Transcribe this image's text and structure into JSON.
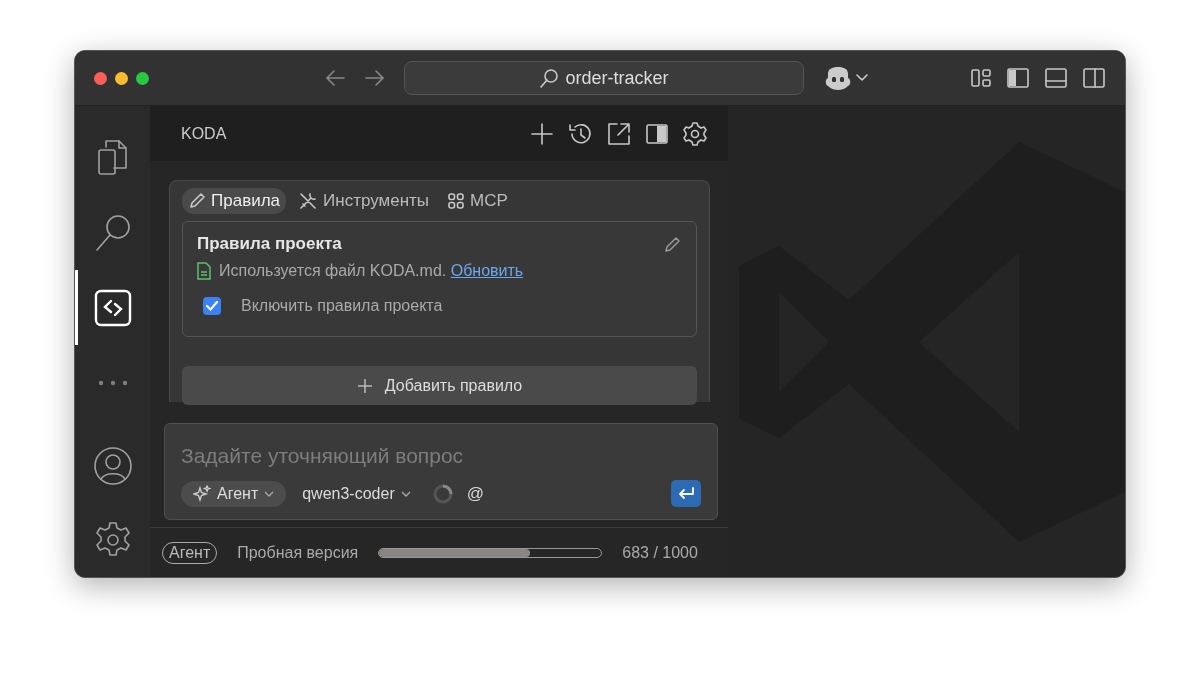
{
  "window": {
    "title": "order-tracker"
  },
  "activity_bar": {
    "items": [
      {
        "kind": "files",
        "selected": false
      },
      {
        "kind": "search",
        "selected": false
      },
      {
        "kind": "koda",
        "selected": true
      },
      {
        "kind": "more",
        "selected": false
      },
      {
        "kind": "account",
        "selected": false
      },
      {
        "kind": "settings",
        "selected": false
      }
    ]
  },
  "panel": {
    "title": "KODA",
    "tabs": [
      {
        "kind": "pencil",
        "label": "Правила",
        "selected": true
      },
      {
        "kind": "tools",
        "label": "Инструменты",
        "selected": false
      },
      {
        "kind": "grid",
        "label": "MCP",
        "selected": false
      }
    ],
    "rules_card": {
      "title": "Правила проекта",
      "file_note": "Используется файл KODA.md.",
      "link": "Обновить",
      "checkbox": {
        "label": "Включить правила проекта",
        "checked": true
      }
    },
    "add_button": "Добавить правило"
  },
  "composer": {
    "placeholder": "Задайте уточняющий вопрос",
    "mode": "Агент",
    "model": "qwen3-coder",
    "mention": "@"
  },
  "status_bar": {
    "badge": "Агент",
    "label": "Пробная версия",
    "usage": {
      "level": 0.68,
      "reading": "683 / 1000"
    }
  }
}
